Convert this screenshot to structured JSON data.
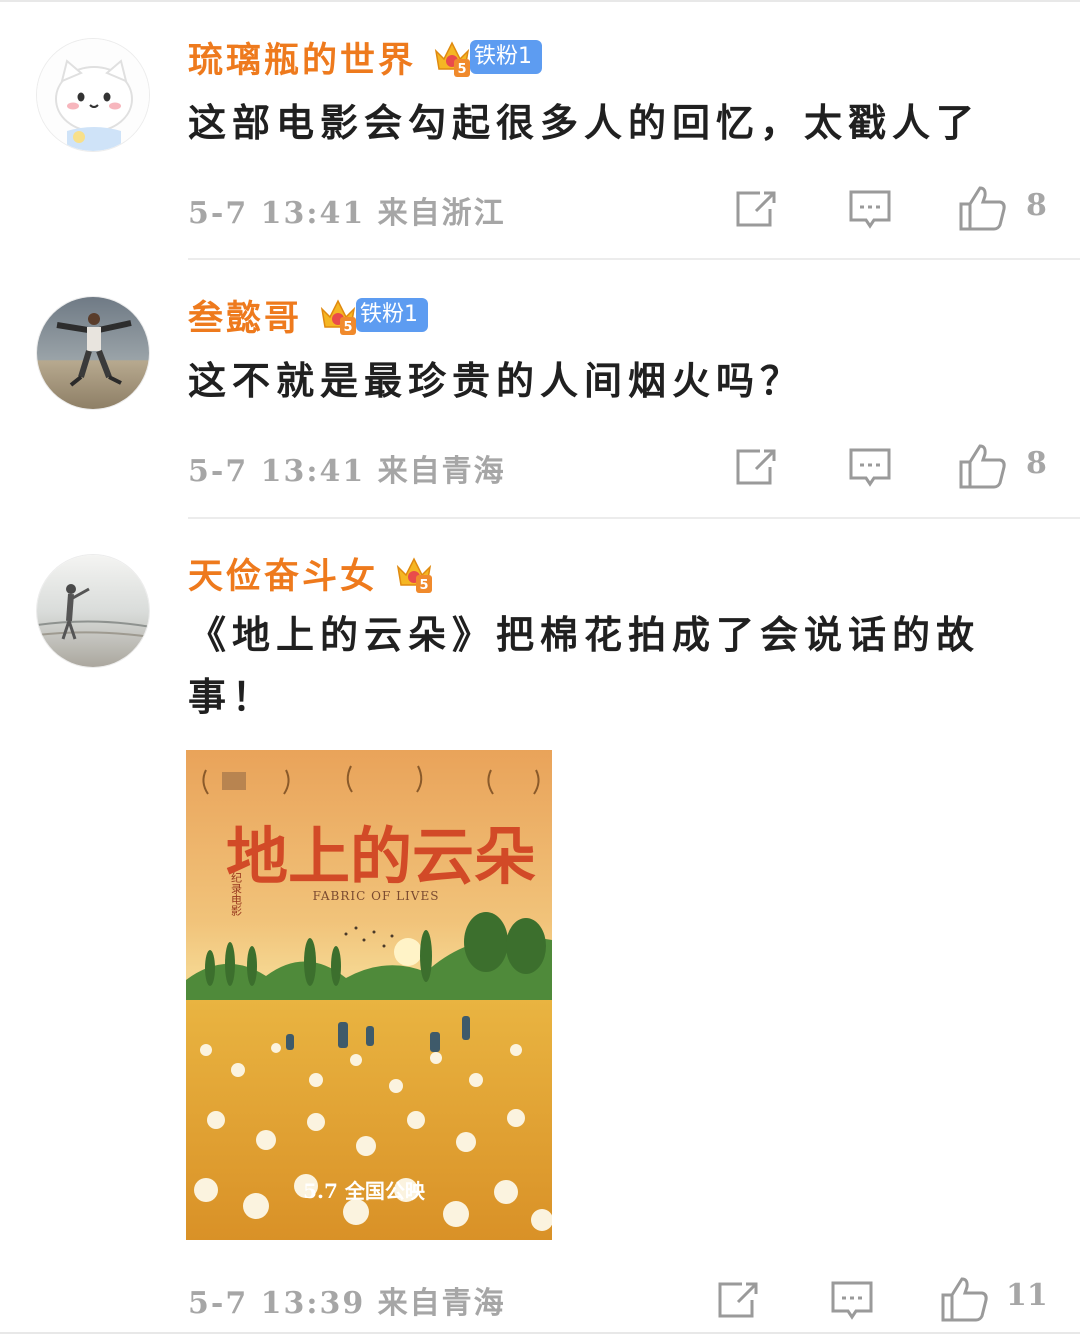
{
  "comments": [
    {
      "username": "琉璃瓶的世界",
      "badge": "铁粉1",
      "crown_level": "5",
      "text": "这部电影会勾起很多人的回忆，太戳人了",
      "meta": "5-7 13:41  来自浙江",
      "likes": "8",
      "avatar": "cartoon-cat-avatar"
    },
    {
      "username": "叁懿哥",
      "badge": "铁粉1",
      "crown_level": "5",
      "text": "这不就是最珍贵的人间烟火吗？",
      "meta": "5-7 13:41  来自青海",
      "likes": "8",
      "avatar": "man-jumping-beach-avatar"
    },
    {
      "username": "天俭奋斗女",
      "crown_level": "5",
      "text_line1": "《地上的云朵》把棉花拍成了会说话的故",
      "text_line2": "事！",
      "meta": "5-7 13:39  来自青海",
      "likes": "11",
      "avatar": "woman-seaside-avatar",
      "image": {
        "title": "地上的云朵",
        "subtitle": "FABRIC OF LIVES",
        "release": "5.7 全国公映",
        "side_label": "纪录电影"
      }
    }
  ],
  "icons": [
    "share-icon",
    "comment-icon",
    "like-icon",
    "crown-icon"
  ],
  "colors": {
    "username": "#ee7a1d",
    "badge": "#5d9cf1",
    "meta": "#a6a6a6",
    "text": "#202020"
  }
}
